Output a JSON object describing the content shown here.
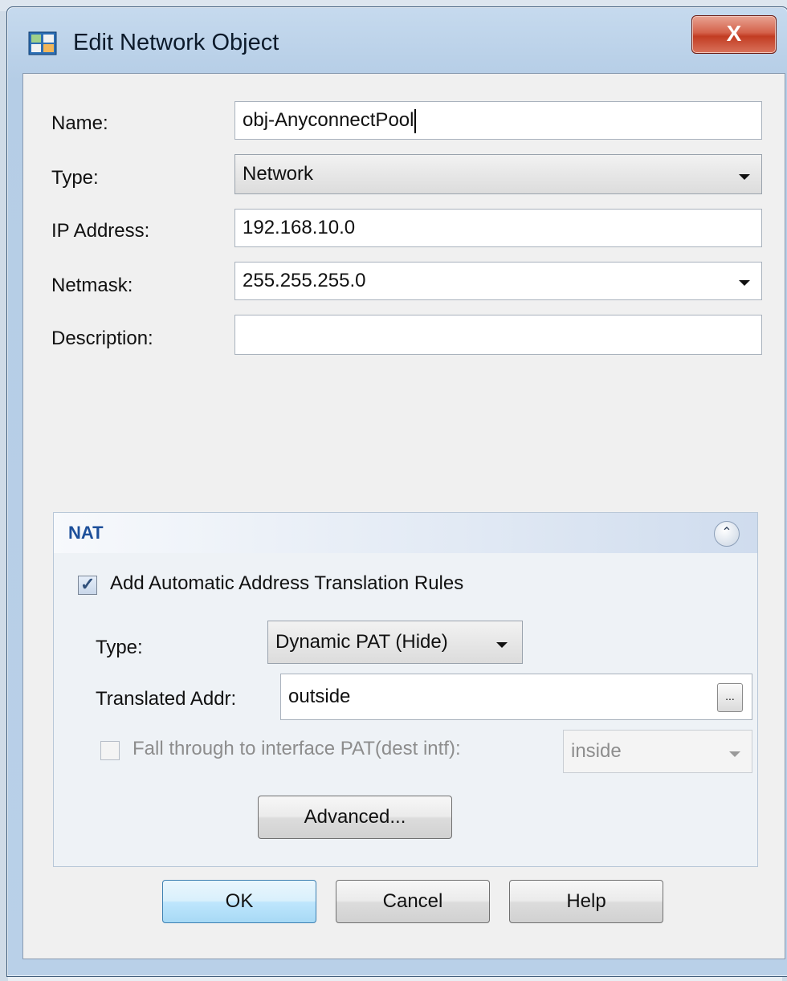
{
  "dialog": {
    "title": "Edit Network Object",
    "close_label": "X"
  },
  "form": {
    "name_label": "Name:",
    "name_value": "obj-AnyconnectPool",
    "type_label": "Type:",
    "type_value": "Network",
    "ip_label": "IP Address:",
    "ip_value": "192.168.10.0",
    "netmask_label": "Netmask:",
    "netmask_value": "255.255.255.0",
    "description_label": "Description:",
    "description_value": ""
  },
  "nat": {
    "title": "NAT",
    "auto_rules_label": "Add Automatic Address Translation Rules",
    "auto_rules_checked": true,
    "type_label": "Type:",
    "type_value": "Dynamic PAT (Hide)",
    "translated_label": "Translated Addr:",
    "translated_value": "outside",
    "browse_label": "...",
    "fallthrough_label": "Fall through to interface PAT(dest intf):",
    "fallthrough_checked": false,
    "fallthrough_intf": "inside",
    "advanced_label": "Advanced..."
  },
  "buttons": {
    "ok": "OK",
    "cancel": "Cancel",
    "help": "Help"
  },
  "colors": {
    "nat_title": "#1d4f9a",
    "close_red": "#c23c22",
    "default_button": "#bee6fd"
  }
}
